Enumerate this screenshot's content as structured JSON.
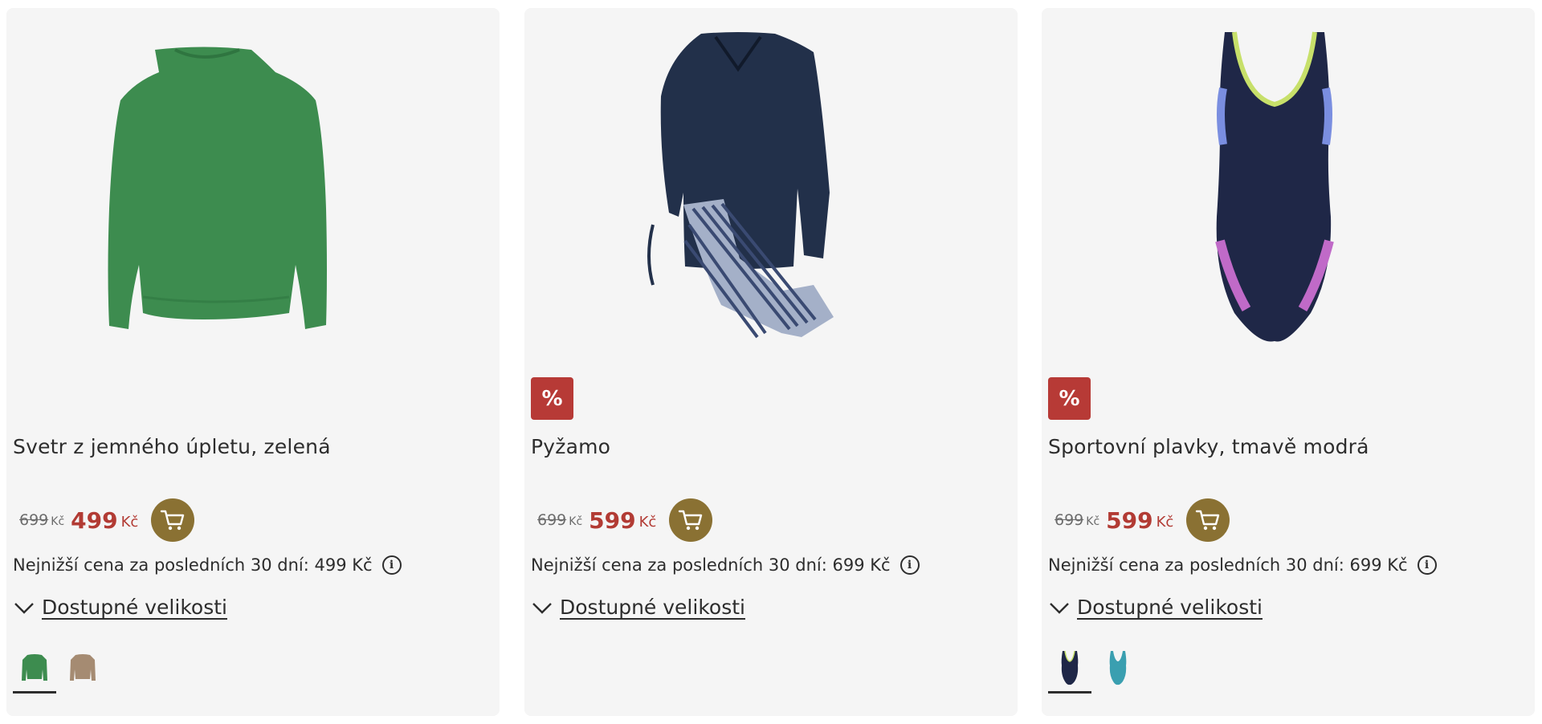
{
  "products": [
    {
      "title": "Svetr z jemného úpletu, zelená",
      "old_price": "699",
      "old_currency": "Kč",
      "new_price": "499",
      "new_currency": "Kč",
      "lowest_price_text": "Nejnižší cena za posledních 30 dní: 499 Kč",
      "sizes_label": "Dostupné velikosti",
      "has_discount_badge": false,
      "swatches": [
        "green",
        "beige"
      ]
    },
    {
      "title": "Pyžamo",
      "badge": "%",
      "old_price": "699",
      "old_currency": "Kč",
      "new_price": "599",
      "new_currency": "Kč",
      "lowest_price_text": "Nejnižší cena za posledních 30 dní: 699 Kč",
      "sizes_label": "Dostupné velikosti",
      "has_discount_badge": true,
      "swatches": []
    },
    {
      "title": "Sportovní plavky, tmavě modrá",
      "badge": "%",
      "old_price": "699",
      "old_currency": "Kč",
      "new_price": "599",
      "new_currency": "Kč",
      "lowest_price_text": "Nejnižší cena za posledních 30 dní: 699 Kč",
      "sizes_label": "Dostupné velikosti",
      "has_discount_badge": true,
      "swatches": [
        "navy",
        "teal"
      ]
    }
  ],
  "icons": {
    "cart": "shopping-cart-icon",
    "info": "info-icon",
    "chevron": "chevron-down-icon"
  },
  "colors": {
    "sale_price": "#b23b34",
    "badge_bg": "#b73a36",
    "cart_button_bg": "#8a7133",
    "card_bg": "#f5f5f5"
  }
}
